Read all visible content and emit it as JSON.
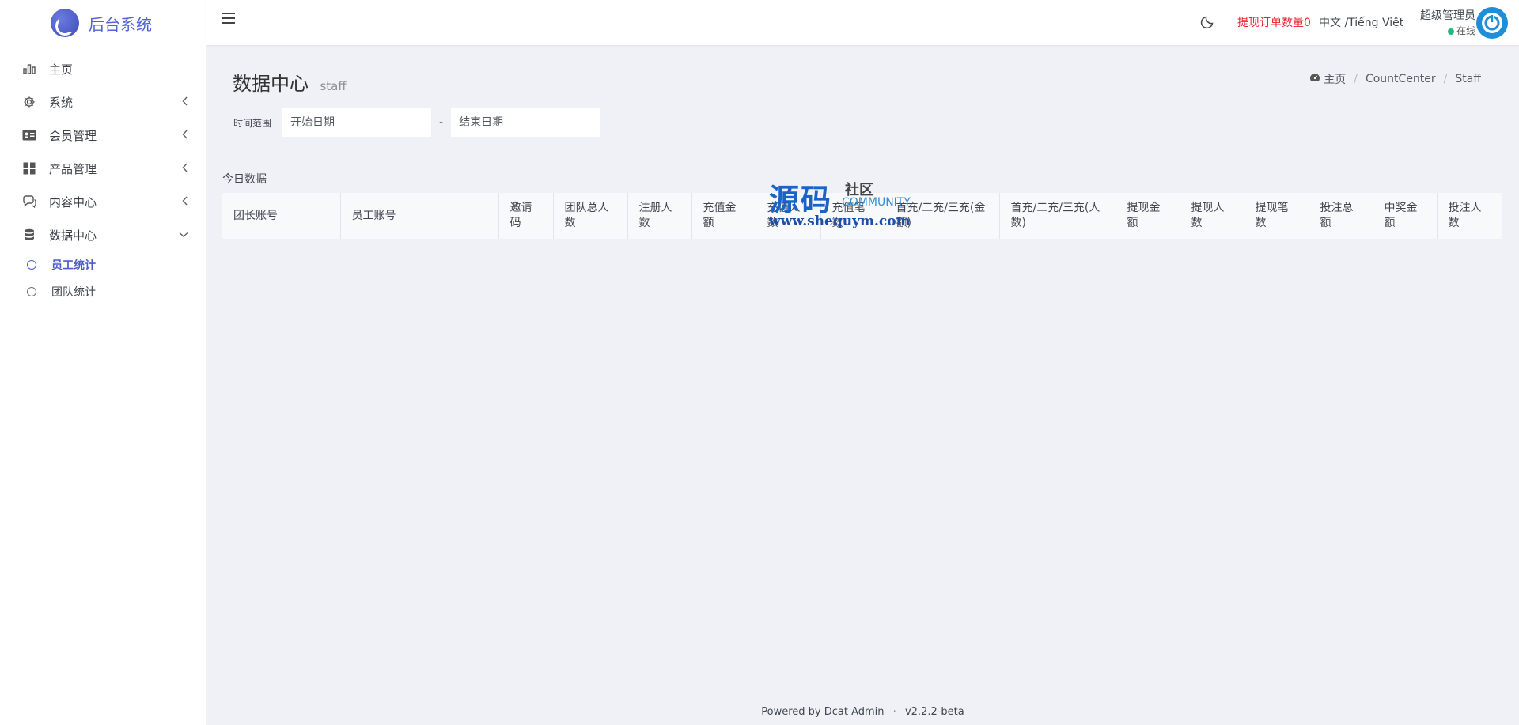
{
  "brand": {
    "title": "后台系统"
  },
  "sidebar": {
    "items": [
      {
        "label": "主页",
        "icon": "bar-chart-icon"
      },
      {
        "label": "系统",
        "icon": "gear-icon"
      },
      {
        "label": "会员管理",
        "icon": "id-card-icon"
      },
      {
        "label": "产品管理",
        "icon": "grid-icon"
      },
      {
        "label": "内容中心",
        "icon": "chat-icon"
      },
      {
        "label": "数据中心",
        "icon": "database-icon"
      }
    ],
    "subitems": [
      {
        "label": "员工统计",
        "active": true
      },
      {
        "label": "团队统计",
        "active": false
      }
    ]
  },
  "navbar": {
    "withdraw_label": "提现订单数量0",
    "language": "中文 /Tiếng Việt",
    "user_name": "超级管理员",
    "user_status": "在线"
  },
  "page": {
    "title": "数据中心",
    "subtitle": "staff"
  },
  "breadcrumb": {
    "home": "主页",
    "level2": "CountCenter",
    "level3": "Staff"
  },
  "filter": {
    "label": "时间范围",
    "start_placeholder": "开始日期",
    "dash": "-",
    "end_placeholder": "结束日期"
  },
  "section": {
    "title": "今日数据"
  },
  "table": {
    "columns": [
      "团长账号",
      "员工账号",
      "邀请码",
      "团队总人数",
      "注册人数",
      "充值金额",
      "充值人数",
      "充值笔数",
      "首充/二充/三充(金额)",
      "首充/二充/三充(人数)",
      "提现金额",
      "提现人数",
      "提现笔数",
      "投注总额",
      "中奖金额",
      "投注人数"
    ]
  },
  "watermark": {
    "big": "源码",
    "small": "社区",
    "community": "COMMUNITY",
    "url": "www.shequym.com"
  },
  "footer": {
    "powered": "Powered by Dcat Admin",
    "sep": "·",
    "version": "v2.2.2-beta"
  },
  "colors": {
    "accent": "#5161d6",
    "warning": "#e9222f",
    "online": "#21b978",
    "background": "#f0f1f6"
  }
}
